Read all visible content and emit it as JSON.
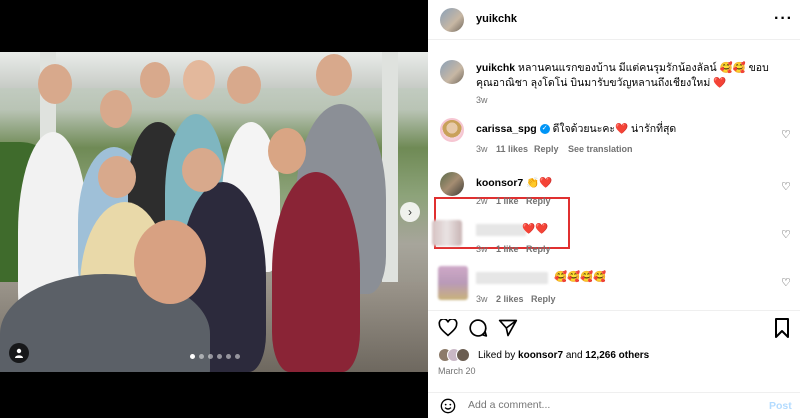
{
  "header": {
    "username": "yuikchk",
    "more_icon": "more-horizontal-icon"
  },
  "caption": {
    "username": "yuikchk",
    "text": "หลานคนแรกของบ้าน มีแต่คนรุมรักน้องลัลน์ 🥰🥰 ขอบคุณอาณิชา ลุงโดโน่ บินมารับขวัญหลานถึงเชียงใหม่ ❤️",
    "time": "3w"
  },
  "comments": [
    {
      "username": "carissa_spg",
      "verified": true,
      "text": "ดีใจด้วยนะคะ❤️ น่ารักที่สุด",
      "time": "3w",
      "likes": "11 likes",
      "reply": "Reply",
      "see_translation": "See translation"
    },
    {
      "username": "koonsor7",
      "text": "👏❤️",
      "time": "2w",
      "likes": "1 like",
      "reply": "Reply"
    },
    {
      "username": "",
      "text": "❤️❤️",
      "time": "3w",
      "likes": "1 like",
      "reply": "Reply"
    },
    {
      "username": "",
      "text": "🥰🥰🥰🥰",
      "time": "3w",
      "likes": "2 likes",
      "reply": "Reply"
    }
  ],
  "liked_by": {
    "prefix": "Liked by",
    "user": "koonsor7",
    "and": "and",
    "others": "12,266 others"
  },
  "date": "March 20",
  "add_comment": {
    "placeholder": "Add a comment...",
    "post_label": "Post"
  },
  "carousel": {
    "dots": 6,
    "active": 0
  },
  "colors": {
    "highlight_border": "#e03030",
    "link_blue": "#b3dbff",
    "verified": "#0095f6",
    "heart": "#e0245e"
  }
}
